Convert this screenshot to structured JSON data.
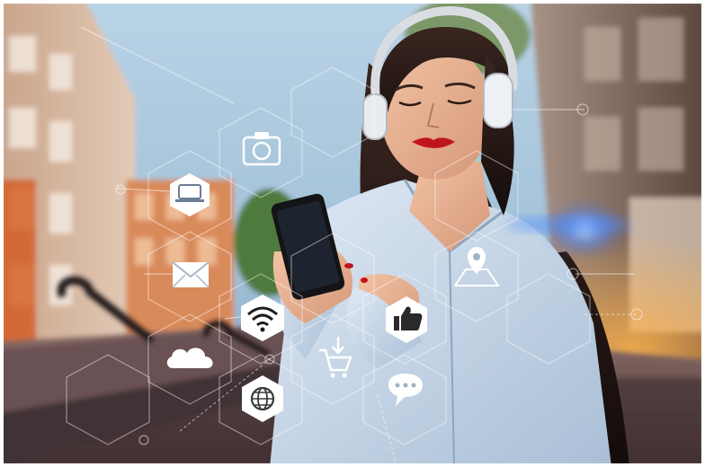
{
  "scene": {
    "subject": "woman-with-headphones-using-smartphone",
    "setting": "city-street-bench",
    "overlay": "hexagon-network-icons"
  },
  "icons": [
    {
      "name": "camera-icon"
    },
    {
      "name": "laptop-icon"
    },
    {
      "name": "mail-icon"
    },
    {
      "name": "wifi-icon"
    },
    {
      "name": "cloud-icon"
    },
    {
      "name": "globe-icon"
    },
    {
      "name": "shopping-cart-icon"
    },
    {
      "name": "location-pin-icon"
    },
    {
      "name": "thumbs-up-icon"
    },
    {
      "name": "chat-bubble-icon"
    }
  ],
  "colors": {
    "sky": "#a9c6da",
    "accent_blue": "#3a7bff",
    "shirt": "#c9d9ea",
    "lips": "#c0141c"
  }
}
